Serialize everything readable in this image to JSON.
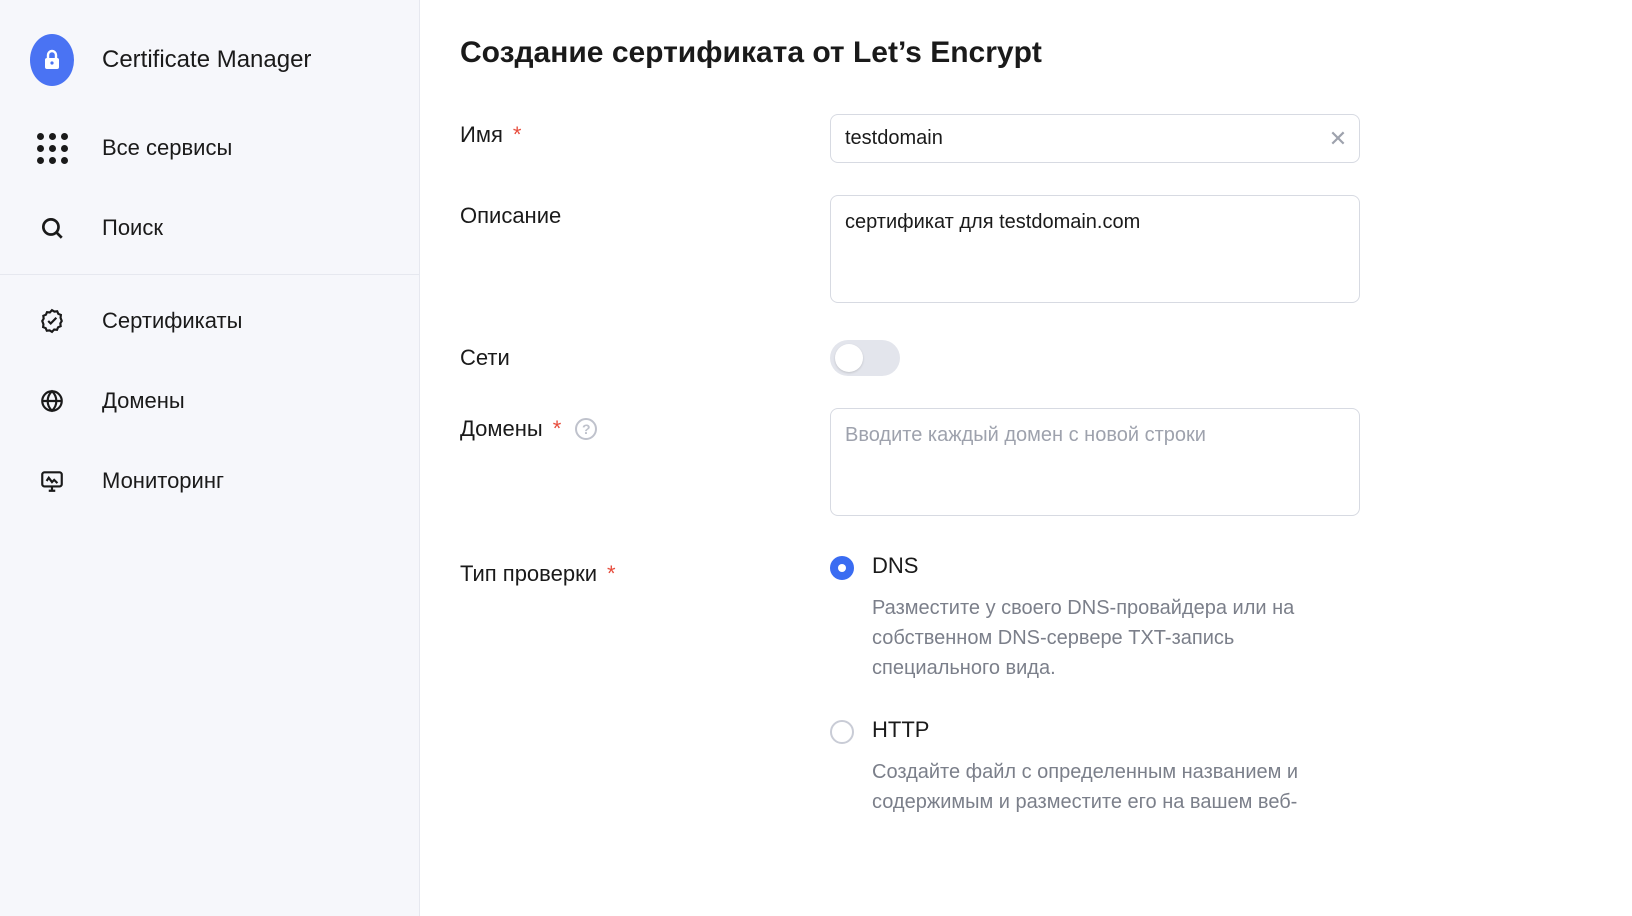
{
  "sidebar": {
    "app_title": "Certificate Manager",
    "all_services": "Все сервисы",
    "search": "Поиск",
    "certificates": "Сертификаты",
    "domains": "Домены",
    "monitoring": "Мониторинг"
  },
  "page": {
    "title": "Создание сертификата от Let’s Encrypt"
  },
  "form": {
    "name_label": "Имя",
    "name_value": "testdomain",
    "description_label": "Описание",
    "description_value": "сертификат для testdomain.com",
    "networks_label": "Сети",
    "networks_on": false,
    "domains_label": "Домены",
    "domains_placeholder": "Вводите каждый домен с новой строки",
    "domains_value": "",
    "check_type_label": "Тип проверки",
    "check_type": {
      "selected": "dns",
      "dns": {
        "title": "DNS",
        "desc": "Разместите у своего DNS-провайдера или на собственном DNS-сервере TXT-запись специального вида."
      },
      "http": {
        "title": "HTTP",
        "desc": "Создайте файл с определенным названием и содержимым и разместите его на вашем веб-"
      }
    }
  }
}
